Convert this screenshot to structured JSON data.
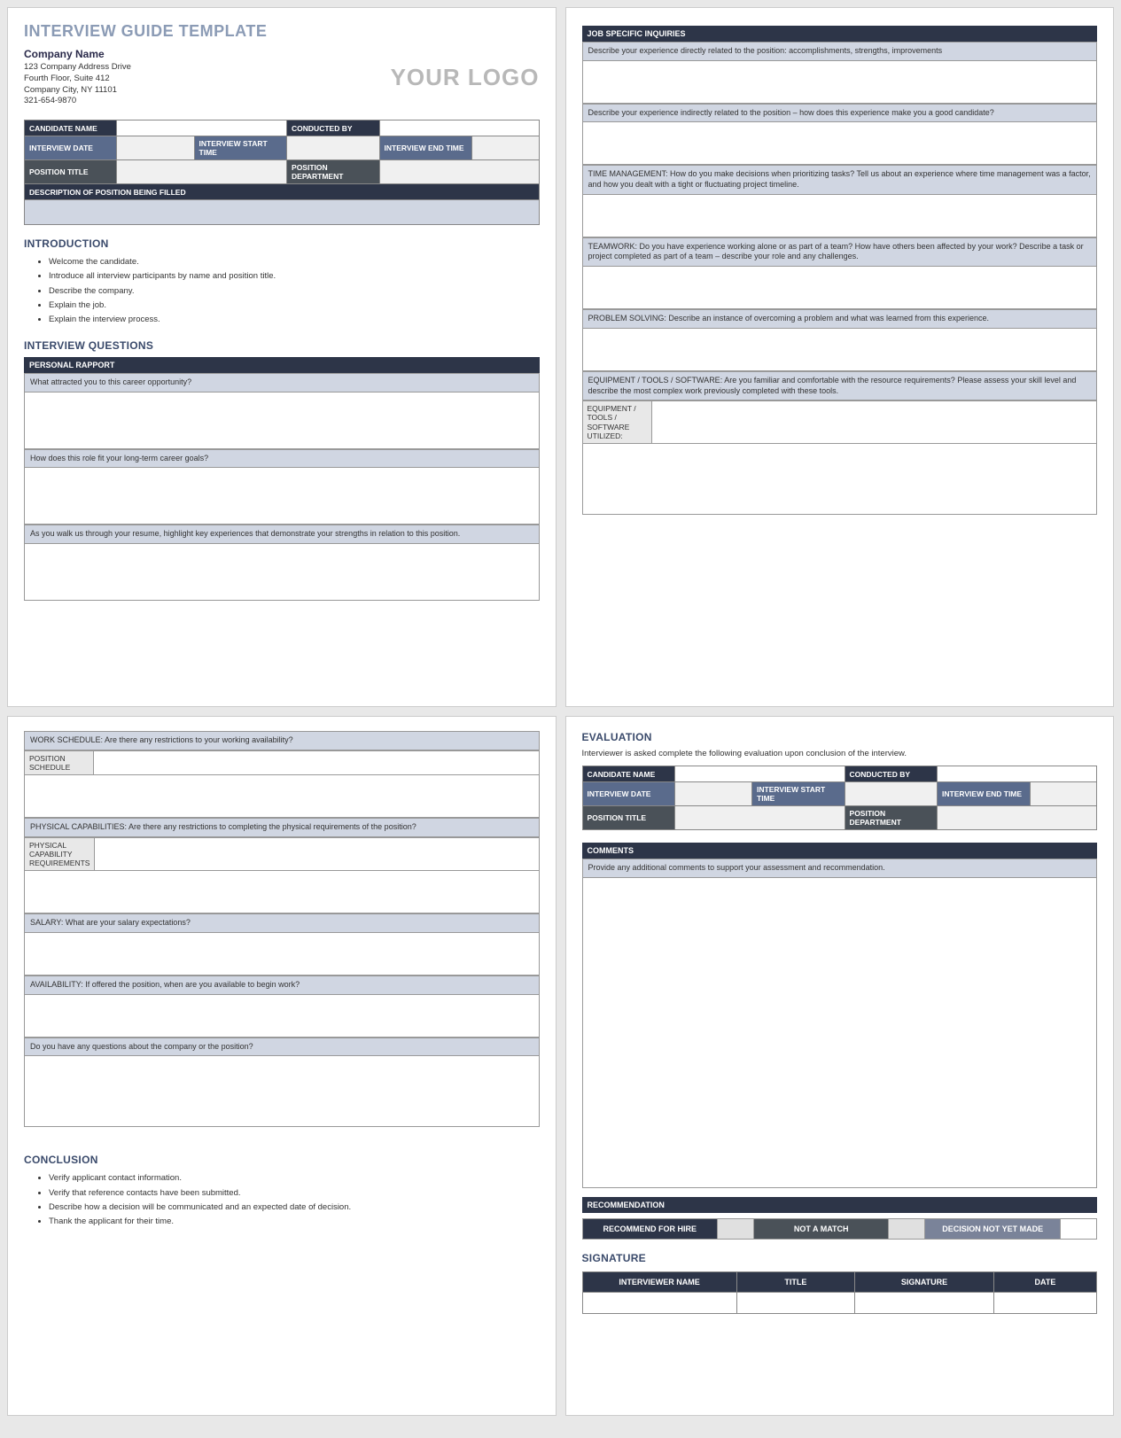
{
  "title": "INTERVIEW GUIDE TEMPLATE",
  "company": {
    "name": "Company Name",
    "addr1": "123 Company Address Drive",
    "addr2": "Fourth Floor, Suite 412",
    "addr3": "Company City, NY  11101",
    "phone": "321-654-9870"
  },
  "logo": "YOUR LOGO",
  "info": {
    "candidate": "CANDIDATE NAME",
    "conducted": "CONDUCTED BY",
    "date": "INTERVIEW DATE",
    "start": "INTERVIEW START TIME",
    "end": "INTERVIEW END TIME",
    "ptitle": "POSITION TITLE",
    "pdept": "POSITION DEPARTMENT",
    "desc": "DESCRIPTION OF POSITION BEING FILLED"
  },
  "intro": {
    "h": "INTRODUCTION",
    "items": [
      "Welcome the candidate.",
      "Introduce all interview participants by name and position title.",
      "Describe the company.",
      "Explain the job.",
      "Explain the interview process."
    ]
  },
  "iq": "INTERVIEW QUESTIONS",
  "rapport": {
    "h": "PERSONAL RAPPORT",
    "q1": "What attracted you to this career opportunity?",
    "q2": "How does this role fit your long-term career goals?",
    "q3": "As you walk us through your resume, highlight key experiences that demonstrate your strengths in relation to this position."
  },
  "job": {
    "h": "JOB SPECIFIC INQUIRIES",
    "q1": "Describe your experience directly related to the position: accomplishments, strengths, improvements",
    "q2": "Describe your experience indirectly related to the position – how does this experience make you a good candidate?",
    "q3": "TIME MANAGEMENT: How do you make decisions when prioritizing tasks? Tell us about an experience where time management was a factor, and how you dealt with a tight or fluctuating project timeline.",
    "q4": "TEAMWORK: Do you have experience working alone or as part of a team? How have others been affected by your work? Describe a task or project completed as part of a team – describe your role and any challenges.",
    "q5": "PROBLEM SOLVING: Describe an instance of overcoming a problem and what was learned from this experience.",
    "q6": "EQUIPMENT / TOOLS / SOFTWARE: Are you familiar and comfortable with the resource requirements? Please assess your skill level and describe the most complex work previously completed with these tools.",
    "q6side": "EQUIPMENT / TOOLS / SOFTWARE UTILIZED:"
  },
  "p3": {
    "q1": "WORK SCHEDULE: Are there any restrictions to your working availability?",
    "q1side": "POSITION SCHEDULE",
    "q2": "PHYSICAL CAPABILITIES: Are there any restrictions to completing the physical requirements of the position?",
    "q2side": "PHYSICAL CAPABILITY REQUIREMENTS",
    "q3": "SALARY: What are your salary expectations?",
    "q4": "AVAILABILITY:  If offered the position, when are you available to begin work?",
    "q5": "Do you have any questions about the company or the position?"
  },
  "concl": {
    "h": "CONCLUSION",
    "items": [
      "Verify applicant contact information.",
      "Verify that reference contacts have been submitted.",
      "Describe how a decision will be communicated and an expected date of decision.",
      "Thank the applicant for their time."
    ]
  },
  "eval": {
    "h": "EVALUATION",
    "intro": "Interviewer is asked complete the following evaluation upon conclusion of the interview."
  },
  "comments": {
    "h": "COMMENTS",
    "q": "Provide any additional comments to support your assessment and recommendation."
  },
  "rec": {
    "h": "RECOMMENDATION",
    "r1": "RECOMMEND FOR HIRE",
    "r2": "NOT A MATCH",
    "r3": "DECISION NOT YET MADE"
  },
  "sig": {
    "h": "SIGNATURE",
    "c1": "INTERVIEWER NAME",
    "c2": "TITLE",
    "c3": "SIGNATURE",
    "c4": "DATE"
  }
}
